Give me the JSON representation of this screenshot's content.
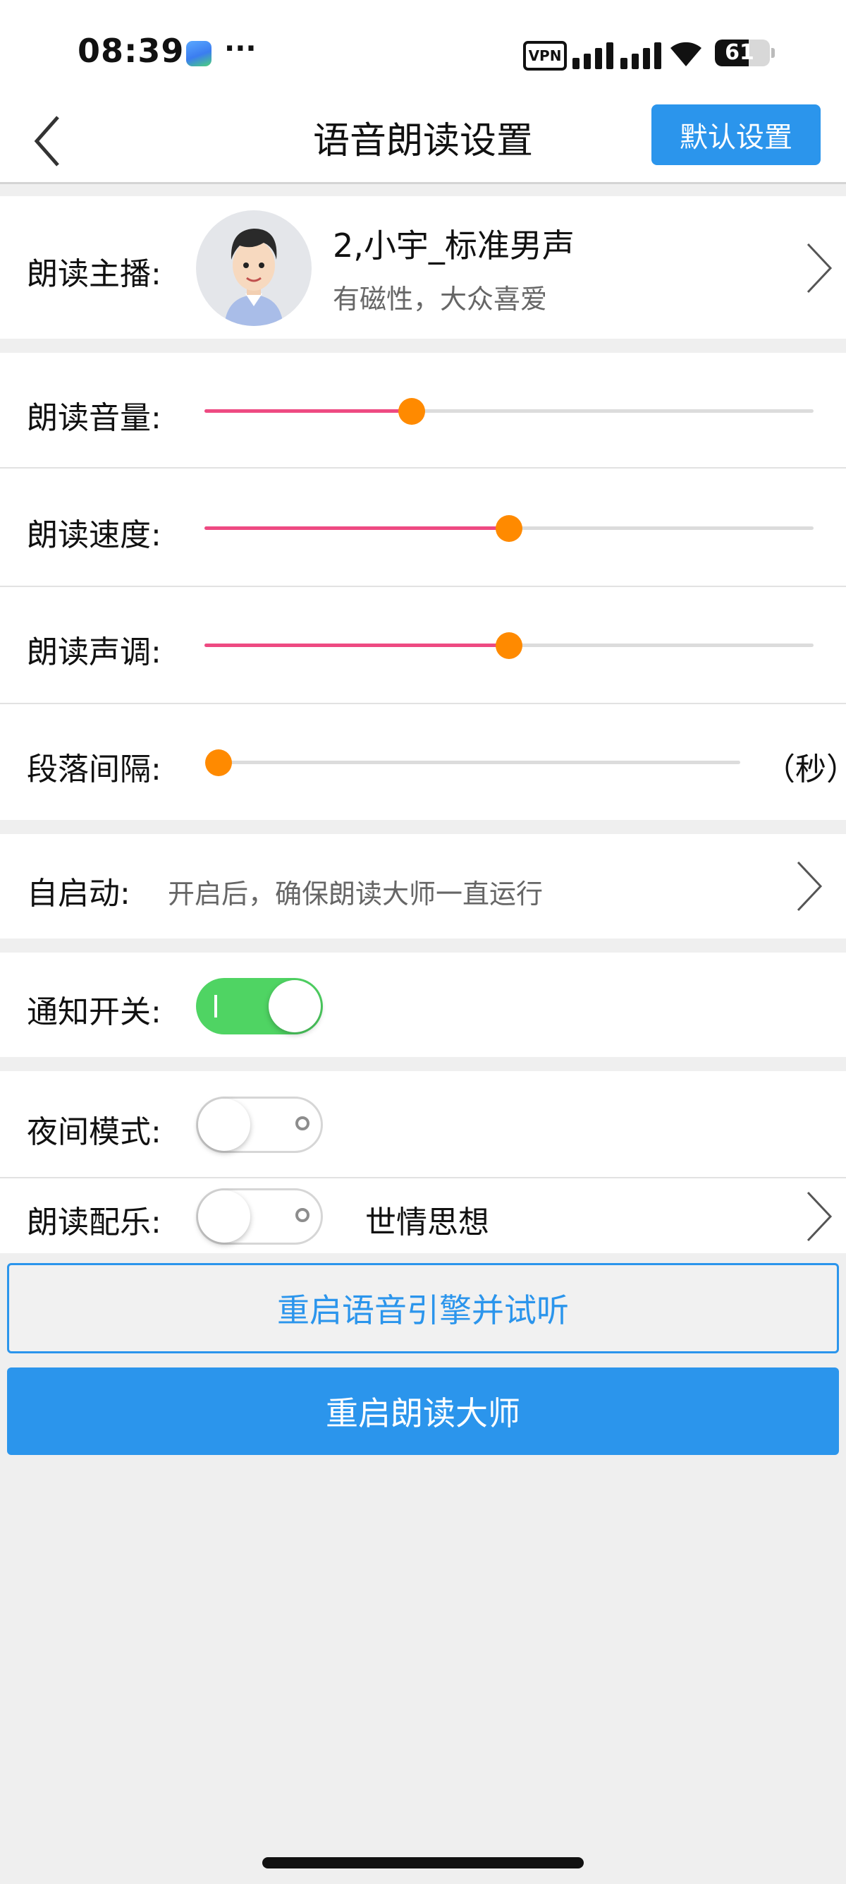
{
  "status_bar": {
    "time": "08:39",
    "more": "···",
    "vpn": "VPN",
    "battery": "61",
    "battery_percent": 61
  },
  "nav": {
    "title": "语音朗读设置",
    "default_button": "默认设置"
  },
  "anchor": {
    "label": "朗读主播:",
    "name": "2,小宇_标准男声",
    "description": "有磁性，大众喜爱"
  },
  "sliders": {
    "volume": {
      "label": "朗读音量:",
      "value": 0.34
    },
    "speed": {
      "label": "朗读速度:",
      "value": 0.5
    },
    "pitch": {
      "label": "朗读声调:",
      "value": 0.5
    },
    "interval": {
      "label": "段落间隔:",
      "value": 0.0,
      "unit": "（秒）"
    }
  },
  "autostart": {
    "label": "自启动:",
    "description": "开启后，确保朗读大师一直运行"
  },
  "toggles": {
    "notification": {
      "label": "通知开关:",
      "on": true
    },
    "night_mode": {
      "label": "夜间模式:",
      "on": false
    },
    "music": {
      "label": "朗读配乐:",
      "on": false,
      "track": "世情思想"
    }
  },
  "buttons": {
    "restart_engine": "重启语音引擎并试听",
    "restart_app": "重启朗读大师"
  },
  "colors": {
    "accent_blue": "#2b95ec",
    "slider_fill": "#ee4a82",
    "slider_thumb": "#ff8a00",
    "toggle_on": "#4fd463"
  }
}
